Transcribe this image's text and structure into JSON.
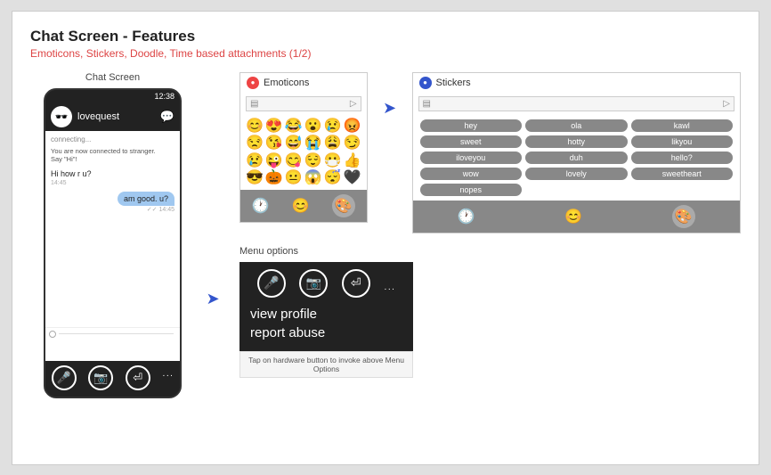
{
  "page": {
    "title": "Chat Screen - Features",
    "subtitle": "Emoticons, Stickers, Doodle, Time based attachments (1/2)"
  },
  "chatScreen": {
    "label": "Chat Screen",
    "statusBar": "12:38",
    "userName": "lovequest",
    "connectingText": "connecting...",
    "systemMessage": "You are now connected to stranger.\nSay \"Hi\"!",
    "msgLeft": "Hi how r u?",
    "msgLeftTime": "14:45",
    "msgRight": "am good. u?",
    "msgRightTime": "14:45",
    "bottomIcons": [
      "🎤",
      "📷",
      "⏎"
    ]
  },
  "emoticonsPanel": {
    "label": "Emoticons",
    "emojis": [
      "😊",
      "😍",
      "😂",
      "😮",
      "😢",
      "😡",
      "😒",
      "😘",
      "😅",
      "😭",
      "😩",
      "😏",
      "😢",
      "😜",
      "😋",
      "😌",
      "😷",
      "👍",
      "😎",
      "🎃",
      "😐",
      "😱",
      "😴",
      "🖤"
    ],
    "bottomIcons": [
      "🕐",
      "😊",
      "🎨"
    ]
  },
  "stickersPanel": {
    "label": "Stickers",
    "tags": [
      "hey",
      "ola",
      "kawl",
      "sweet",
      "hotty",
      "likyou",
      "iloveyou",
      "duh",
      "hello?",
      "wow",
      "lovely",
      "sweetheart",
      "nopes"
    ],
    "bottomIcons": [
      "🕐",
      "😊",
      "🎨"
    ]
  },
  "menuPanel": {
    "label": "Menu options",
    "icons": [
      "🎤",
      "📷",
      "⏎"
    ],
    "items": [
      "view profile",
      "report abuse"
    ],
    "footer": "Tap on hardware button to invoke above Menu Options",
    "moreLabel": "..."
  }
}
